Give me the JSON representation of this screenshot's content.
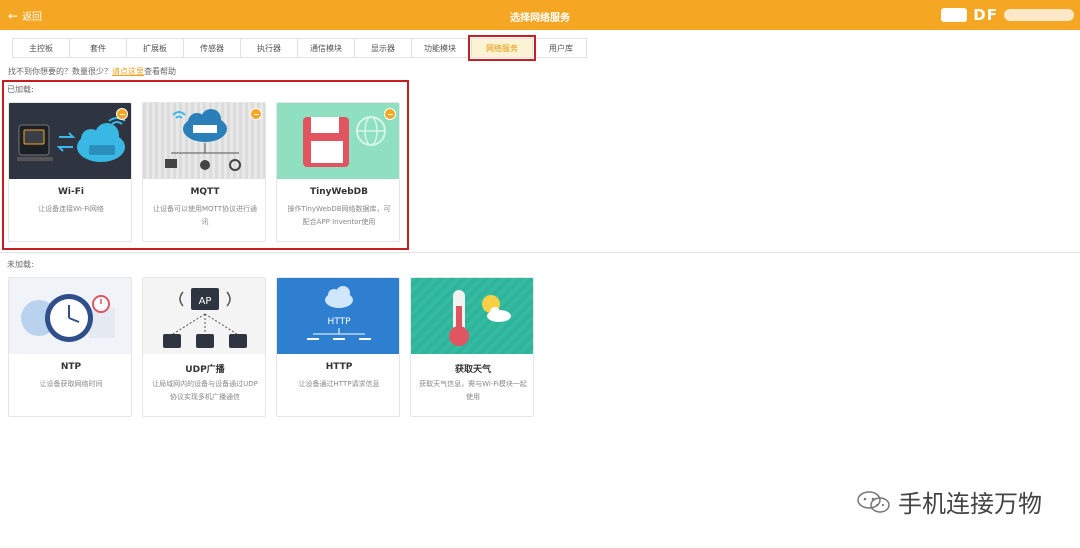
{
  "header": {
    "back_label": "返回",
    "title": "选择网络服务",
    "brand": "DF",
    "accent_color": "#f5a623"
  },
  "tabs": [
    {
      "label": "主控板",
      "active": false
    },
    {
      "label": "套件",
      "active": false
    },
    {
      "label": "扩展板",
      "active": false
    },
    {
      "label": "传感器",
      "active": false
    },
    {
      "label": "执行器",
      "active": false
    },
    {
      "label": "通信模块",
      "active": false
    },
    {
      "label": "显示器",
      "active": false
    },
    {
      "label": "功能模块",
      "active": false
    },
    {
      "label": "网络服务",
      "active": true
    },
    {
      "label": "用户库",
      "active": false
    }
  ],
  "help": {
    "prefix": "找不到你想要的？数量很少？",
    "link": "请点这里",
    "suffix": "查看帮助"
  },
  "loaded": {
    "label": "已加载:",
    "cards": [
      {
        "name": "Wi-Fi",
        "desc": "让设备连接Wi-Fi网络",
        "icon": "wifi-cloud-icon"
      },
      {
        "name": "MQTT",
        "desc": "让设备可以使用MQTT协议进行通讯",
        "icon": "mqtt-cloud-icon"
      },
      {
        "name": "TinyWebDB",
        "desc": "操作TinyWebDB网络数据库，可配合APP Inventor使用",
        "icon": "floppy-disk-icon"
      }
    ]
  },
  "unloaded": {
    "label": "未加载:",
    "cards": [
      {
        "name": "NTP",
        "desc": "让设备获取网络时间",
        "icon": "clock-icon"
      },
      {
        "name": "UDP广播",
        "desc": "让局域网内的设备与设备通过UDP协议实现多机广播通信",
        "icon": "udp-ap-icon"
      },
      {
        "name": "HTTP",
        "desc": "让设备通过HTTP请求信息",
        "icon": "http-cloud-icon"
      },
      {
        "name": "获取天气",
        "desc": "获取天气信息，需与Wi-Fi模块一起使用",
        "icon": "weather-icon"
      }
    ]
  },
  "watermark": {
    "text": "手机连接万物"
  }
}
